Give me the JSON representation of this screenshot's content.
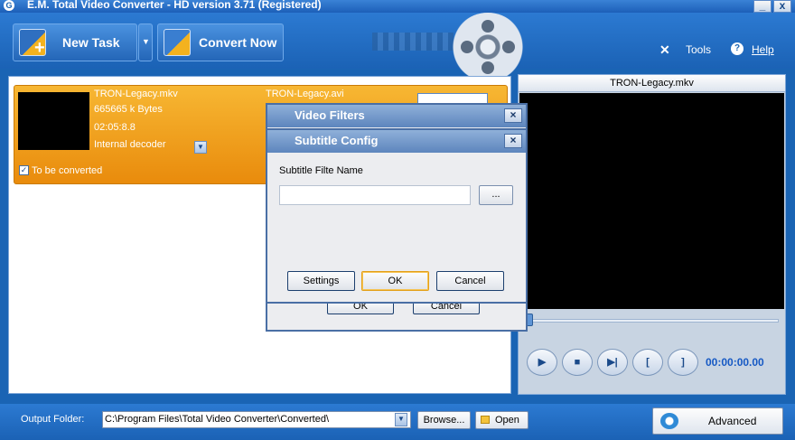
{
  "window": {
    "title": "E.M. Total Video Converter -  HD version 3.71 (Registered)",
    "minimize_glyph": "_",
    "close_glyph": "x"
  },
  "toolbar": {
    "new_task_label": "New Task",
    "convert_now_label": "Convert Now",
    "dropdown_glyph": "▼",
    "tools_label": "Tools",
    "help_label": "Help"
  },
  "task": {
    "source_name": "TRON-Legacy.mkv",
    "size": "665665 k Bytes",
    "duration": "02:05:8.8",
    "decoder": "Internal decoder",
    "target_name": "TRON-Legacy.avi",
    "to_be_converted_label": "To be converted",
    "checked": true
  },
  "preview": {
    "title": "TRON-Legacy.mkv",
    "timecode": "00:00:00.00",
    "position": 0.0,
    "controls": {
      "play": "▶",
      "stop": "■",
      "next": "▶|",
      "mark_in": "[",
      "mark_out": "]"
    }
  },
  "bottom": {
    "output_folder_label": "Output Folder:",
    "output_path": "C:\\Program Files\\Total Video Converter\\Converted\\",
    "browse_label": "Browse...",
    "open_label": "Open",
    "advanced_label": "Advanced"
  },
  "video_filters_dialog": {
    "title": "Video Filters",
    "ok_label": "OK",
    "cancel_label": "Cancel"
  },
  "subtitle_dialog": {
    "title": "Subtitle Config",
    "file_name_label": "Subtitle Filte Name",
    "file_name_value": "",
    "browse_label": "...",
    "settings_label": "Settings",
    "ok_label": "OK",
    "cancel_label": "Cancel"
  },
  "colors": {
    "accent": "#1a64b4",
    "task_orange": "#f2a623",
    "timecode_blue": "#1659c4"
  },
  "icons": [
    "app-icon",
    "new-task-icon",
    "convert-now-icon",
    "film-reel-icon",
    "tools-icon",
    "help-icon",
    "refresh-icon",
    "folder-icon"
  ]
}
